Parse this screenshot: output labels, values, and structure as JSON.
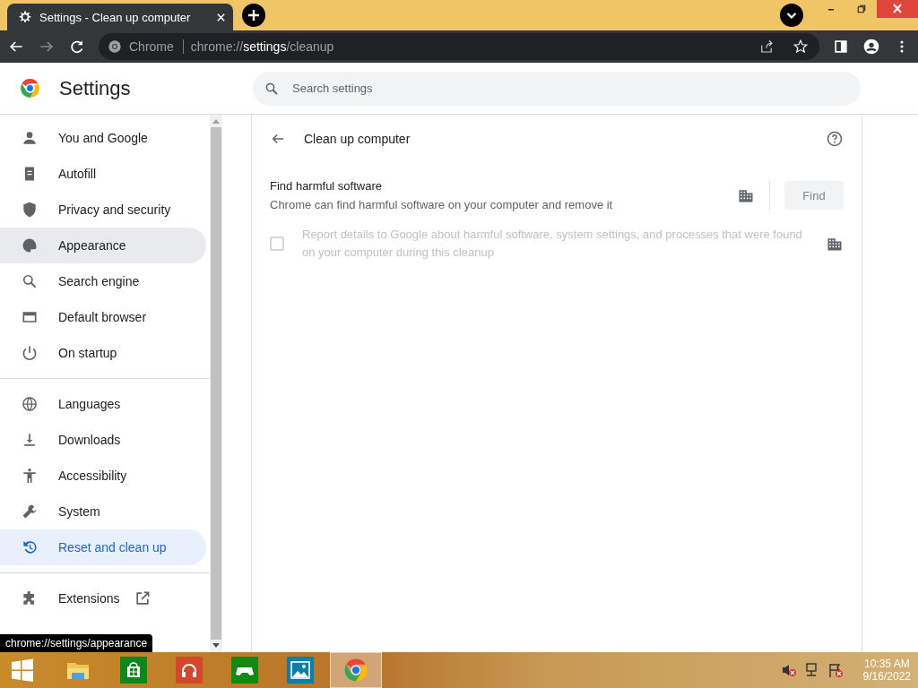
{
  "tab": {
    "title": "Settings - Clean up computer"
  },
  "omnibox": {
    "site": "Chrome",
    "url_prefix": "chrome://",
    "url_host": "settings",
    "url_path": "/cleanup"
  },
  "header": {
    "title": "Settings",
    "search": {
      "placeholder": "Search settings"
    }
  },
  "sidebar": {
    "groups": [
      {
        "items": [
          {
            "label": "You and Google",
            "selected": false,
            "hovered": false
          },
          {
            "label": "Autofill",
            "selected": false,
            "hovered": false
          },
          {
            "label": "Privacy and security",
            "selected": false,
            "hovered": false
          },
          {
            "label": "Appearance",
            "selected": false,
            "hovered": true
          },
          {
            "label": "Search engine",
            "selected": false,
            "hovered": false
          },
          {
            "label": "Default browser",
            "selected": false,
            "hovered": false
          },
          {
            "label": "On startup",
            "selected": false,
            "hovered": false
          }
        ]
      },
      {
        "items": [
          {
            "label": "Languages",
            "selected": false,
            "hovered": false
          },
          {
            "label": "Downloads",
            "selected": false,
            "hovered": false
          },
          {
            "label": "Accessibility",
            "selected": false,
            "hovered": false
          },
          {
            "label": "System",
            "selected": false,
            "hovered": false
          },
          {
            "label": "Reset and clean up",
            "selected": true,
            "hovered": false
          }
        ]
      },
      {
        "items": [
          {
            "label": "Extensions",
            "selected": false,
            "hovered": false,
            "external": true
          }
        ]
      }
    ]
  },
  "page": {
    "title": "Clean up computer",
    "find": {
      "title": "Find harmful software",
      "description": "Chrome can find harmful software on your computer and remove it",
      "button": "Find",
      "disabled": true
    },
    "report": {
      "label": "Report details to Google about harmful software, system settings, and processes that were found on your computer during this cleanup",
      "checked": false,
      "disabled": true
    }
  },
  "status_tooltip": "chrome://settings/appearance",
  "taskbar": {
    "time": "10:35 AM",
    "date": "9/16/2022"
  }
}
